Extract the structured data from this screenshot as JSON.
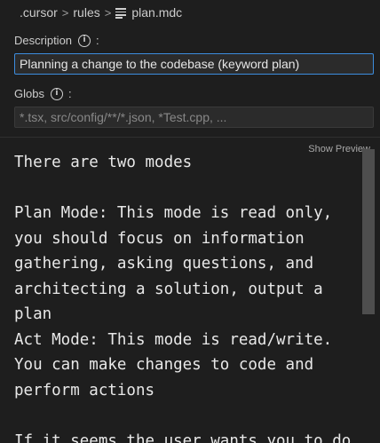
{
  "breadcrumb": {
    "folder": ".cursor",
    "subfolder": "rules",
    "separator": ">",
    "file": "plan.mdc",
    "file_icon": "file-lines-icon"
  },
  "description": {
    "label": "Description",
    "colon": ":",
    "value": "Planning a change to the codebase (keyword plan)"
  },
  "globs": {
    "label": "Globs",
    "colon": ":",
    "placeholder": "*.tsx, src/config/**/*.json, *Test.cpp, ..."
  },
  "editor": {
    "show_preview_label": "Show Preview",
    "content": "There are two modes\n\nPlan Mode: This mode is read only, you should focus on information gathering, asking questions, and architecting a solution, output a plan\nAct Mode: This mode is read/write. You can make changes to code and perform actions\n\nIf it seems the user wants you to do"
  },
  "info_icon_glyph": "i"
}
